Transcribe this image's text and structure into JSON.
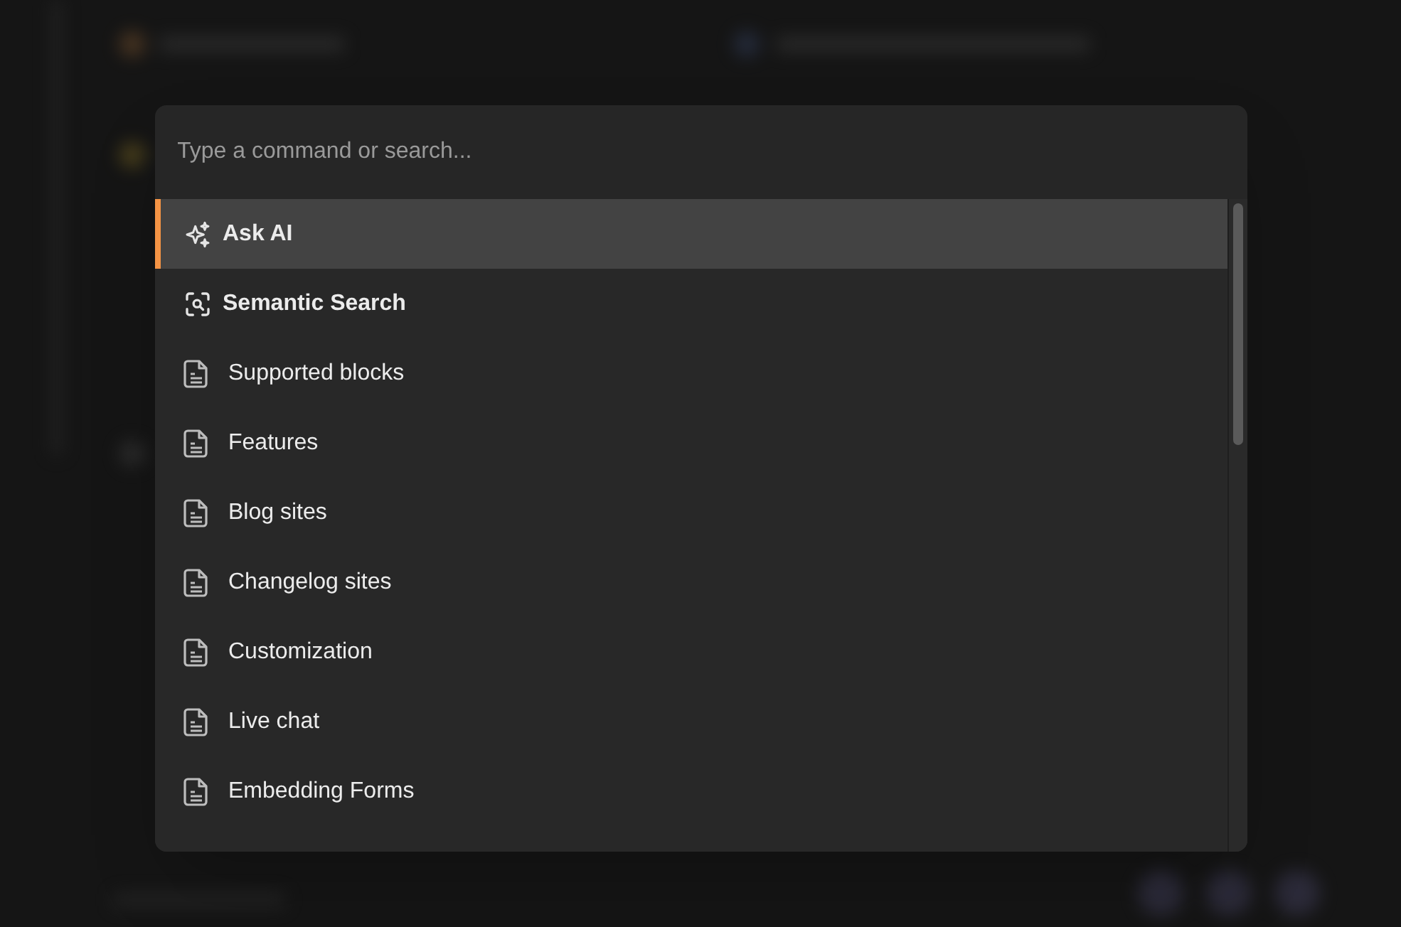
{
  "command_palette": {
    "search": {
      "placeholder": "Type a command or search..."
    },
    "items": [
      {
        "kind": "ai",
        "label": "Ask AI",
        "selected": true
      },
      {
        "kind": "semantic",
        "label": "Semantic Search",
        "selected": false
      },
      {
        "kind": "page",
        "label": "Supported blocks",
        "selected": false
      },
      {
        "kind": "page",
        "label": "Features",
        "selected": false
      },
      {
        "kind": "page",
        "label": "Blog sites",
        "selected": false
      },
      {
        "kind": "page",
        "label": "Changelog sites",
        "selected": false
      },
      {
        "kind": "page",
        "label": "Customization",
        "selected": false
      },
      {
        "kind": "page",
        "label": "Live chat",
        "selected": false
      },
      {
        "kind": "page",
        "label": "Embedding Forms",
        "selected": false
      }
    ]
  }
}
